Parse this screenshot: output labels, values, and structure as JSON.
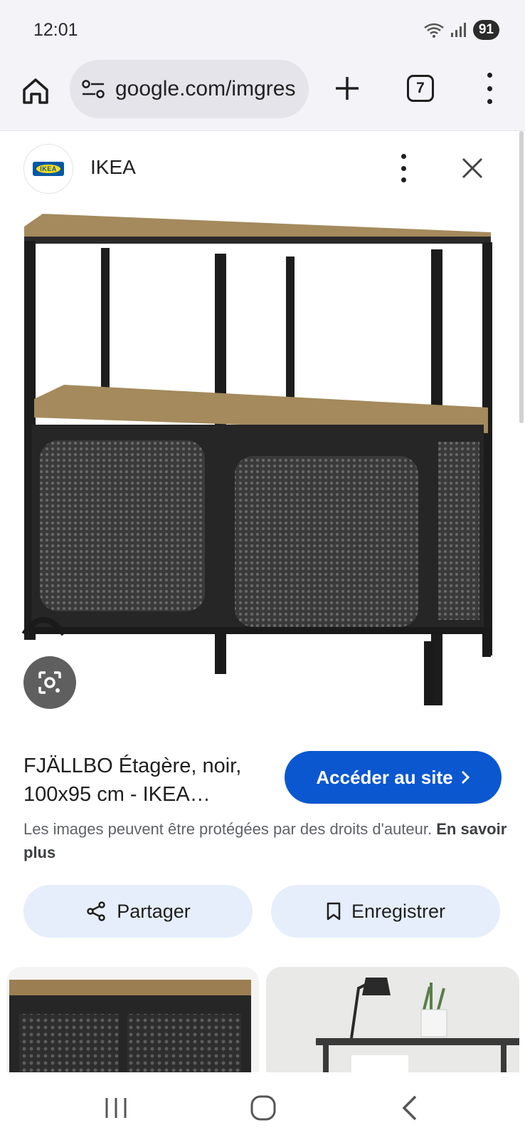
{
  "status_bar": {
    "time": "12:01",
    "battery": "91",
    "icons": [
      "wifi-icon",
      "signal-icon",
      "battery-icon"
    ]
  },
  "browser": {
    "url": "google.com/imgres",
    "tab_count": "7"
  },
  "source": {
    "name": "IKEA",
    "logo_text": "IKEA"
  },
  "product": {
    "title": "FJÄLLBO Étagère, noir, 100x95 cm - IKEA…",
    "visit_label": "Accéder au site"
  },
  "copyright": {
    "text": "Les images peuvent être protégées par des droits d'auteur.",
    "link": "En savoir plus"
  },
  "actions": {
    "share": "Partager",
    "save": "Enregistrer"
  },
  "colors": {
    "accent": "#0b57d0",
    "chip_bg": "#e6eefb",
    "toolbar_bg": "#f3f3f8"
  }
}
